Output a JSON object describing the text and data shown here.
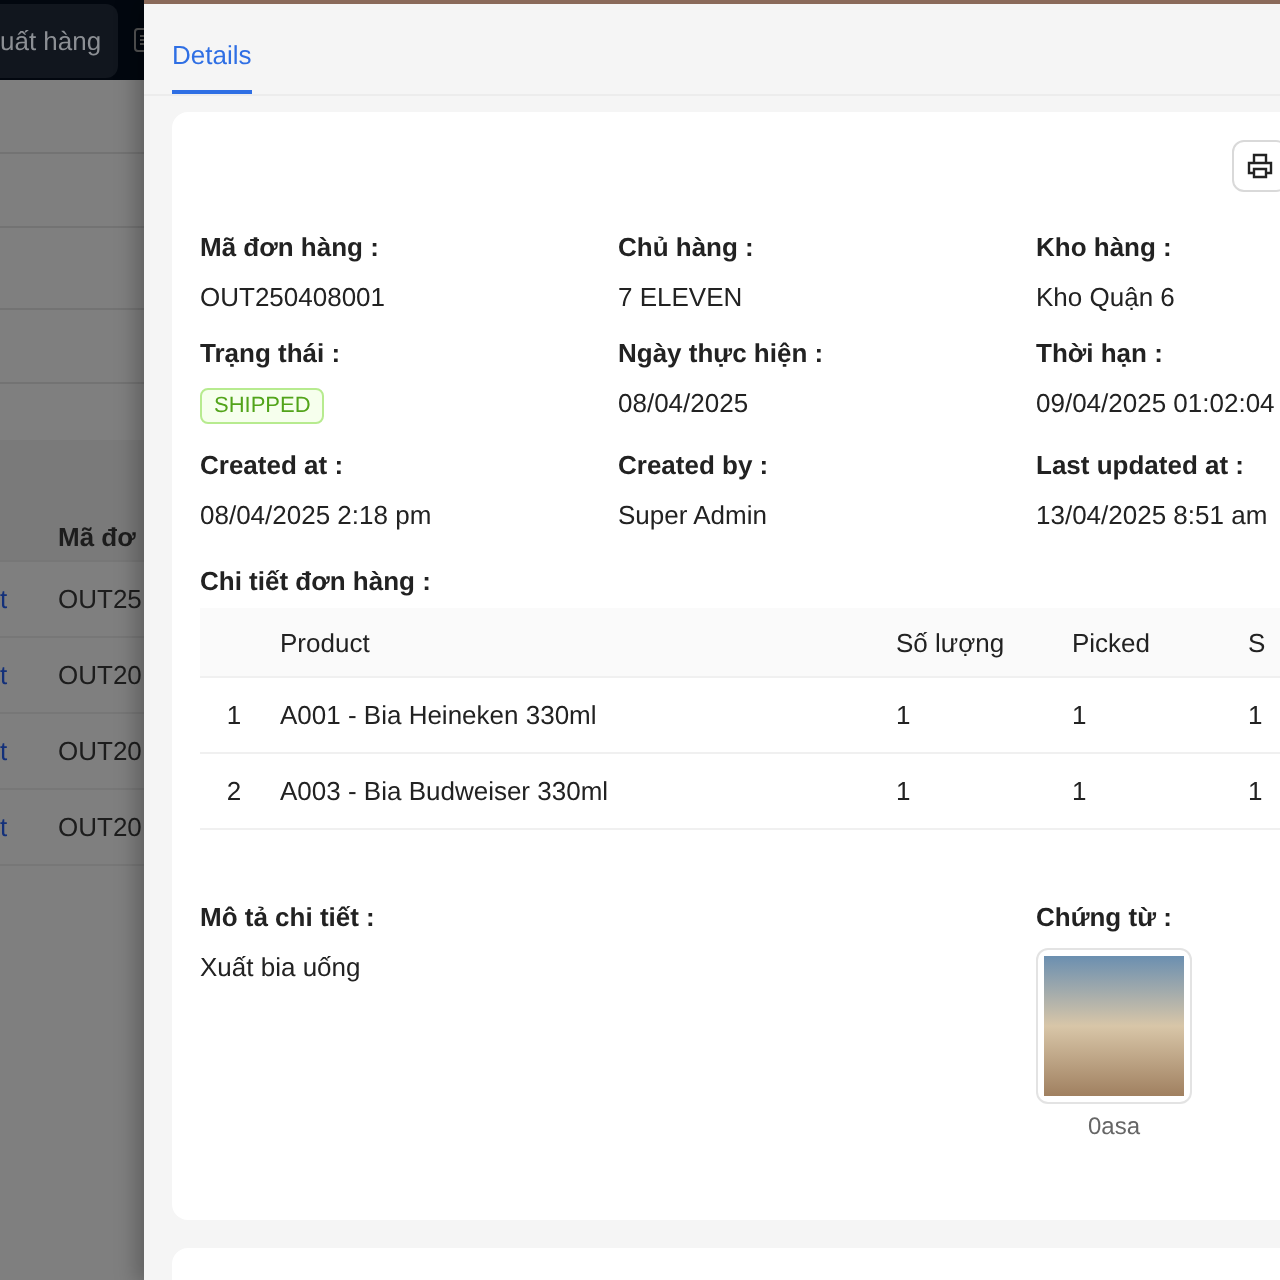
{
  "background_page": {
    "header_tab": "uất hàng",
    "table_heading": "Mã đơ",
    "rows": [
      {
        "link": "t",
        "code": "OUT25"
      },
      {
        "link": "t",
        "code": "OUT20"
      },
      {
        "link": "t",
        "code": "OUT20"
      },
      {
        "link": "t",
        "code": "OUT20"
      }
    ]
  },
  "drawer": {
    "tabs": [
      {
        "label": "Details",
        "selected": true
      }
    ],
    "fields": [
      {
        "label": "Mã đơn hàng :",
        "value": "OUT250408001",
        "kind": "text"
      },
      {
        "label": "Chủ hàng :",
        "value": "7 ELEVEN",
        "kind": "text"
      },
      {
        "label": "Kho hàng :",
        "value": "Kho Quận 6",
        "kind": "text"
      },
      {
        "label": "Trạng thái :",
        "value": "SHIPPED",
        "kind": "tag"
      },
      {
        "label": "Ngày thực hiện :",
        "value": "08/04/2025",
        "kind": "text"
      },
      {
        "label": "Thời hạn :",
        "value": "09/04/2025 01:02:04",
        "kind": "text"
      },
      {
        "label": "Created at :",
        "value": "08/04/2025 2:18 pm",
        "kind": "text"
      },
      {
        "label": "Created by :",
        "value": "Super Admin",
        "kind": "text"
      },
      {
        "label": "Last updated at :",
        "value": "13/04/2025 8:51 am",
        "kind": "text"
      }
    ],
    "order_details": {
      "title": "Chi tiết đơn hàng :",
      "columns": [
        "Product",
        "Số lượng",
        "Picked",
        "S"
      ],
      "rows": [
        {
          "index": "1",
          "product": "A001 - Bia Heineken 330ml",
          "quantity": "1",
          "picked": "1",
          "column_5": "1"
        },
        {
          "index": "2",
          "product": "A003 - Bia Budweiser 330ml",
          "quantity": "1",
          "picked": "1",
          "column_5": "1"
        }
      ]
    },
    "description": {
      "label": "Mô tả chi tiết :",
      "value": "Xuất bia uống"
    },
    "attachments": {
      "label": "Chứng từ :",
      "files": [
        {
          "name": "0asa"
        }
      ]
    }
  }
}
